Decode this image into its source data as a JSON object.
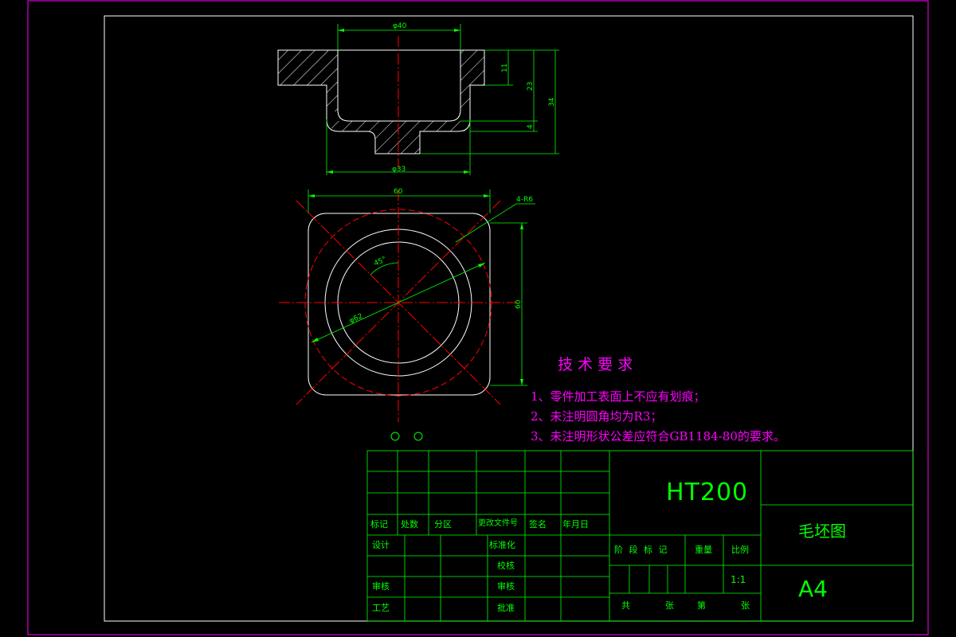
{
  "section_view": {
    "dim_top_diameter": "φ40",
    "dim_bottom_diameter": "φ33",
    "dim_depth_11": "11",
    "dim_depth_23": "23",
    "dim_height_34": "34",
    "dim_bottom_4": "4"
  },
  "plan_view": {
    "dim_width": "60",
    "dim_height": "60",
    "dim_corner_radius": "4-R6",
    "dim_angle": "45°",
    "dim_circle_diameter": "φ62"
  },
  "tech_requirements": {
    "title": "技 术 要 求",
    "items": [
      "1、零件加工表面上不应有划痕；",
      "2、未注明圆角均为R3；",
      "3、未注明形状公差应符合GB1184-80的要求。"
    ]
  },
  "title_block": {
    "material": "HT200",
    "drawing_name": "毛坯图",
    "paper_size": "A4",
    "scale": "1:1",
    "labels": {
      "mark": "标记",
      "count": "处数",
      "zone": "分区",
      "change_doc": "更改文件号",
      "signature": "签名",
      "date": "年月日",
      "design": "设计",
      "standardize": "标准化",
      "check": "审核",
      "process": "工艺",
      "phase_mark": "阶 段 标 记",
      "weight": "重量",
      "ratio": "比例",
      "total": "共",
      "sheets": "张",
      "nth": "第",
      "sheet": "张",
      "audit": "审核",
      "approve": "批准"
    },
    "labels_right": {
      "proof": "校核",
      "approve": "批准"
    }
  },
  "colors": {
    "frame": "#ff00ff",
    "outline": "#ffffff",
    "dimension": "#00ff00",
    "centerline": "#ff0000",
    "tech_text": "#ff00ff"
  }
}
